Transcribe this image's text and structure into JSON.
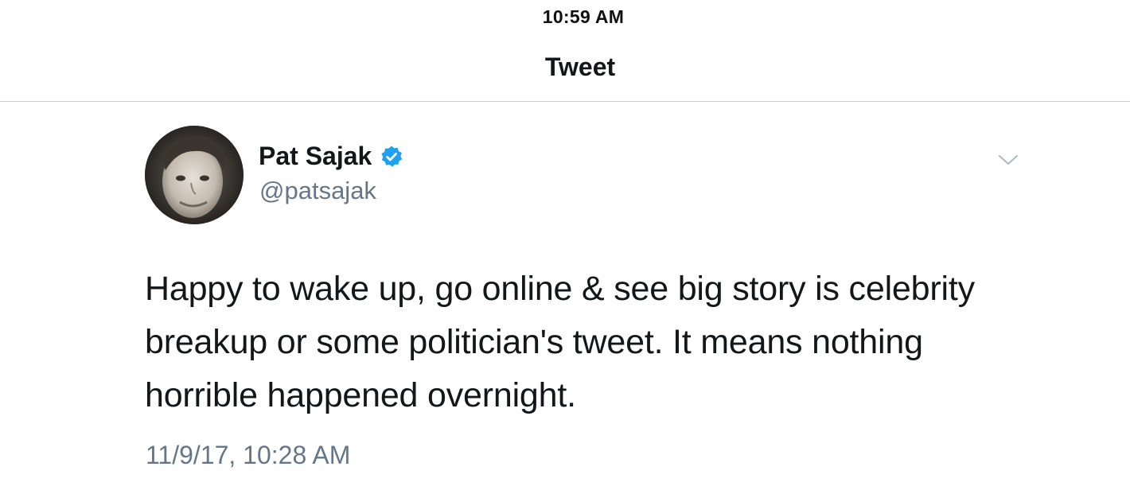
{
  "status_bar": {
    "time": "10:59 AM"
  },
  "nav": {
    "title": "Tweet"
  },
  "tweet": {
    "author": {
      "display_name": "Pat Sajak",
      "handle": "@patsajak",
      "verified": true
    },
    "text": "Happy to wake up, go online & see big story is celebrity breakup or some politician's tweet. It means nothing horrible happened overnight.",
    "timestamp": "11/9/17, 10:28 AM"
  },
  "icons": {
    "verified": "verified-badge-icon",
    "more": "chevron-down-icon"
  },
  "colors": {
    "text_primary": "#14171a",
    "text_secondary": "#657786",
    "verified_blue": "#1da1f2",
    "divider": "#c8ccd0",
    "chevron": "#aab8c2"
  }
}
